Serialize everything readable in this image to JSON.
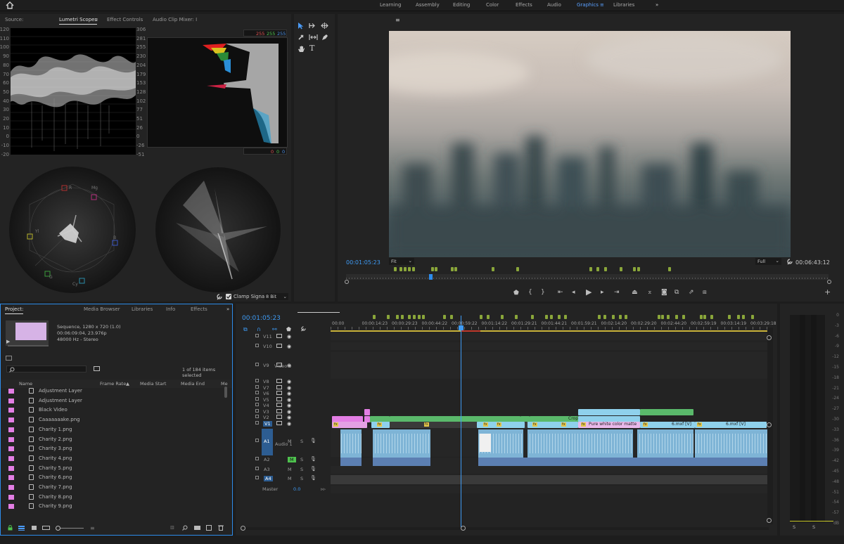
{
  "workspaces": {
    "items": [
      "Learning",
      "Assembly",
      "Editing",
      "Color",
      "Effects",
      "Audio",
      "Graphics",
      "Libraries"
    ],
    "active": "Graphics",
    "menu_glyph": "≡",
    "overflow_glyph": "»"
  },
  "scopes_panel": {
    "tabs": {
      "source": "Source:",
      "lumetri": "Lumetri Scopes",
      "lumetri_menu": "≡",
      "effect_controls": "Effect Controls",
      "audio_mixer": "Audio Clip Mixer: I"
    },
    "waveform_scale_left": [
      "120",
      "110",
      "100",
      "90",
      "80",
      "70",
      "60",
      "50",
      "40",
      "30",
      "20",
      "10",
      "0",
      "-10",
      "-20"
    ],
    "waveform_scale_right": [
      "306",
      "281",
      "255",
      "230",
      "204",
      "179",
      "153",
      "128",
      "102",
      "77",
      "51",
      "26",
      "0",
      "-26",
      "-51"
    ],
    "histogram_top_values": [
      "255",
      "255",
      "255"
    ],
    "histogram_bottom_values": [
      "0",
      "0",
      "0"
    ],
    "vectorscope_labels": [
      "R",
      "Mg",
      "B",
      "Cy",
      "G",
      "Yl"
    ],
    "clamp_signal_label": "Clamp Signal",
    "bit_depth": "8 Bit"
  },
  "colors": {
    "accent": "#2d8ceb",
    "timecode_blue": "#3e9bf5",
    "marker_green": "#8aa63a",
    "clip_pink": "#e37ee4",
    "clip_light_blue": "#8fd1ec",
    "clip_green": "#5ab96b",
    "audio_clip": "#7eb4d6",
    "audio_wave": "#b8dff2"
  },
  "program_monitor": {
    "menu_glyph": "≡",
    "current_timecode": "00:01:05:23",
    "zoom": "Fit",
    "resolution": "Full",
    "duration": "00:06:43:12"
  },
  "project_panel": {
    "tabs": {
      "project": "Project:",
      "media_browser": "Media Browser",
      "libraries": "Libraries",
      "info": "Info",
      "effects": "Effects",
      "overflow": "»"
    },
    "sequence_info": [
      "Sequence, 1280 x 720 (1.0)",
      "00:06:09:04, 23.976p",
      "48000 Hz - Stereo"
    ],
    "items_selected": "1 of 184 items selected",
    "columns": [
      "Name",
      "Frame Rate",
      "Media Start",
      "Media End",
      "Me"
    ],
    "sort_glyph": "▲",
    "items": [
      "Adjustment Layer",
      "Adjustment Layer",
      "Black Video",
      "Caaaaaaake.png",
      "Charity 1.png",
      "Charity 2.png",
      "Charity 3.png",
      "Charity 4.png",
      "Charity 5.png",
      "Charity 6.png",
      "Charity 7.png",
      "Charity 8.png",
      "Charity 9.png"
    ]
  },
  "timeline": {
    "timecode": "00:01:05:23",
    "ruler": [
      "00:00",
      "00:00:14:23",
      "00:00:29:23",
      "00:00:44:22",
      "00:00:59:22",
      "00:01:14:22",
      "00:01:29:21",
      "00:01:44:21",
      "00:01:59:21",
      "00:02:14:20",
      "00:02:29:20",
      "00:02:44:20",
      "00:02:59:19",
      "00:03:14:19",
      "00:03:29:18"
    ],
    "video_tracks": [
      "V11",
      "V10",
      "V9",
      "V8",
      "V7",
      "V6",
      "V5",
      "V4",
      "V3",
      "V2",
      "V1"
    ],
    "track_names": {
      "v9": "Video 9",
      "a1": "Audio 1",
      "master": "Master"
    },
    "audio_tracks": [
      "A1",
      "A2",
      "A3",
      "A4"
    ],
    "master_value": "0.0",
    "clip_labels": {
      "white_matte": "Pure white color matte",
      "mxf_a": "6.mxf [V]",
      "mxf_b": "6.mxf [V]",
      "crop": "Crop",
      "fx": "fx"
    },
    "m_label": "M",
    "s_label": "S"
  },
  "meter": {
    "scale": [
      "0",
      "-3",
      "-6",
      "-9",
      "-12",
      "-15",
      "-18",
      "-21",
      "-24",
      "-27",
      "-30",
      "-33",
      "-36",
      "-39",
      "-42",
      "-45",
      "-48",
      "-51",
      "-54",
      "-57",
      "dB"
    ],
    "solo": [
      "S",
      "S"
    ]
  }
}
